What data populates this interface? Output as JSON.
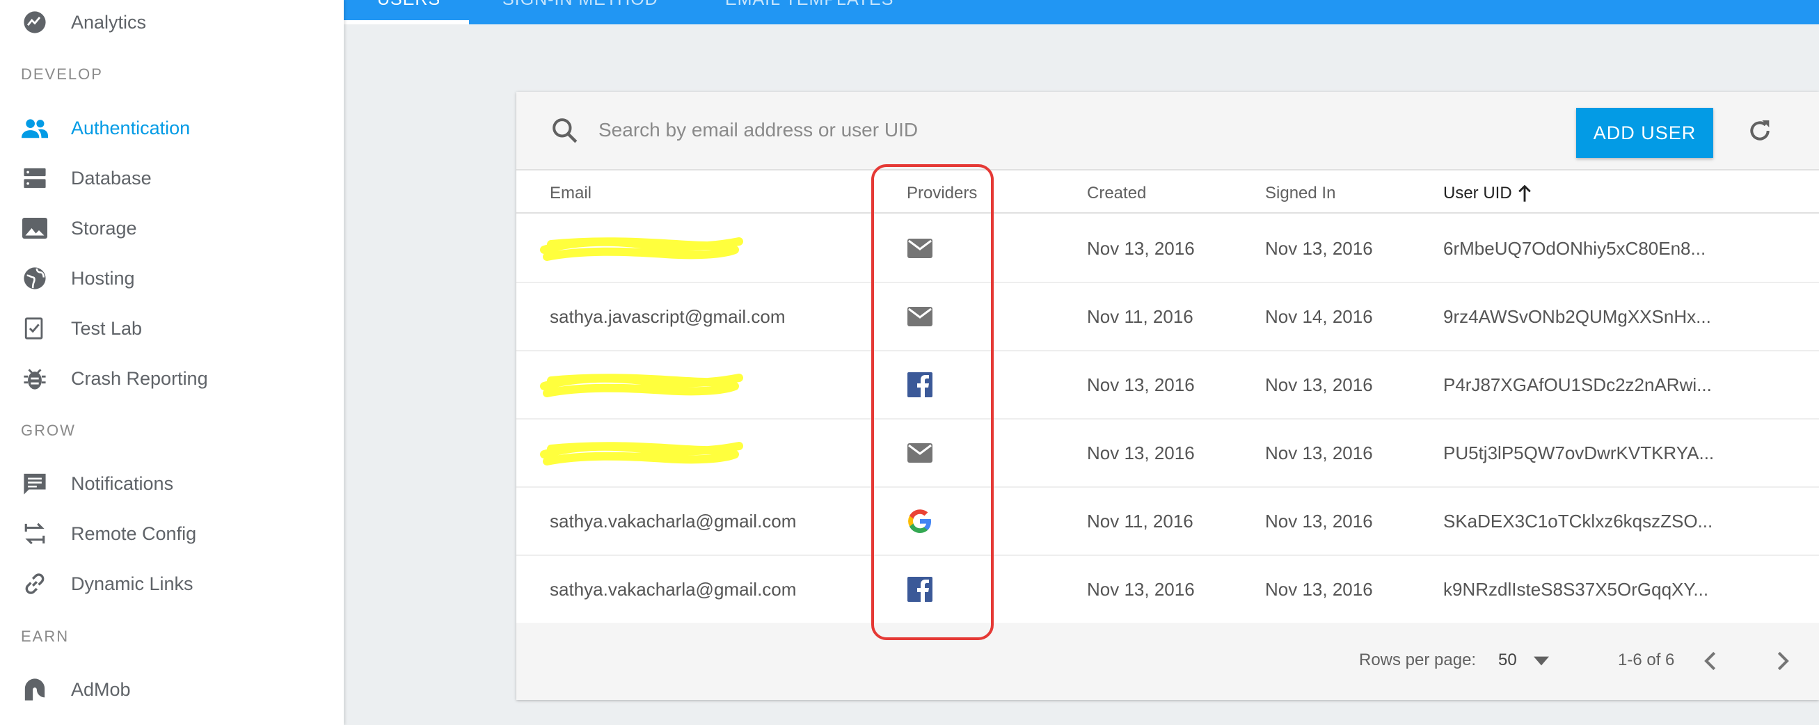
{
  "sidebar": {
    "items": [
      {
        "label": "Analytics",
        "icon": "analytics-icon"
      },
      {
        "label": "Authentication",
        "icon": "people-icon",
        "active": true
      },
      {
        "label": "Database",
        "icon": "database-icon"
      },
      {
        "label": "Storage",
        "icon": "image-icon"
      },
      {
        "label": "Hosting",
        "icon": "globe-icon"
      },
      {
        "label": "Test Lab",
        "icon": "checklist-icon"
      },
      {
        "label": "Crash Reporting",
        "icon": "bug-icon"
      },
      {
        "label": "Notifications",
        "icon": "message-icon"
      },
      {
        "label": "Remote Config",
        "icon": "swap-icon"
      },
      {
        "label": "Dynamic Links",
        "icon": "link-icon"
      },
      {
        "label": "AdMob",
        "icon": "admob-icon"
      }
    ],
    "sections": {
      "develop": "DEVELOP",
      "grow": "GROW",
      "earn": "EARN"
    }
  },
  "tabs": [
    {
      "label": "USERS",
      "active": true
    },
    {
      "label": "SIGN-IN METHOD"
    },
    {
      "label": "EMAIL TEMPLATES"
    }
  ],
  "search": {
    "placeholder": "Search by email address or user UID"
  },
  "add_user_label": "ADD USER",
  "table": {
    "headers": {
      "email": "Email",
      "providers": "Providers",
      "created": "Created",
      "signed_in": "Signed In",
      "uid": "User UID"
    },
    "rows": [
      {
        "email": "",
        "provider": "email-icon",
        "created": "Nov 13, 2016",
        "signed_in": "Nov 13, 2016",
        "uid": "6rMbeUQ7OdONhiy5xC80En8..."
      },
      {
        "email": "sathya.javascript@gmail.com",
        "provider": "email-icon",
        "created": "Nov 11, 2016",
        "signed_in": "Nov 14, 2016",
        "uid": "9rz4AWSvONb2QUMgXXSnHx..."
      },
      {
        "email": "",
        "provider": "facebook-icon",
        "created": "Nov 13, 2016",
        "signed_in": "Nov 13, 2016",
        "uid": "P4rJ87XGAfOU1SDc2z2nARwi..."
      },
      {
        "email": "",
        "provider": "email-icon",
        "created": "Nov 13, 2016",
        "signed_in": "Nov 13, 2016",
        "uid": "PU5tj3lP5QW7ovDwrKVTKRYA..."
      },
      {
        "email": "sathya.vakacharla@gmail.com",
        "provider": "google-icon",
        "created": "Nov 11, 2016",
        "signed_in": "Nov 13, 2016",
        "uid": "SKaDEX3C1oTCklxz6kqszZSO..."
      },
      {
        "email": "sathya.vakacharla@gmail.com",
        "provider": "facebook-icon",
        "created": "Nov 13, 2016",
        "signed_in": "Nov 13, 2016",
        "uid": "k9NRzdlIsteS8S37X5OrGqqXY..."
      }
    ]
  },
  "footer": {
    "rows_per_page_label": "Rows per page:",
    "rows_per_page_value": "50",
    "range": "1-6 of 6"
  },
  "colors": {
    "accent": "#039be5",
    "topbar": "#2196f3",
    "highlight": "#e53935",
    "redaction": "#ffff33"
  }
}
